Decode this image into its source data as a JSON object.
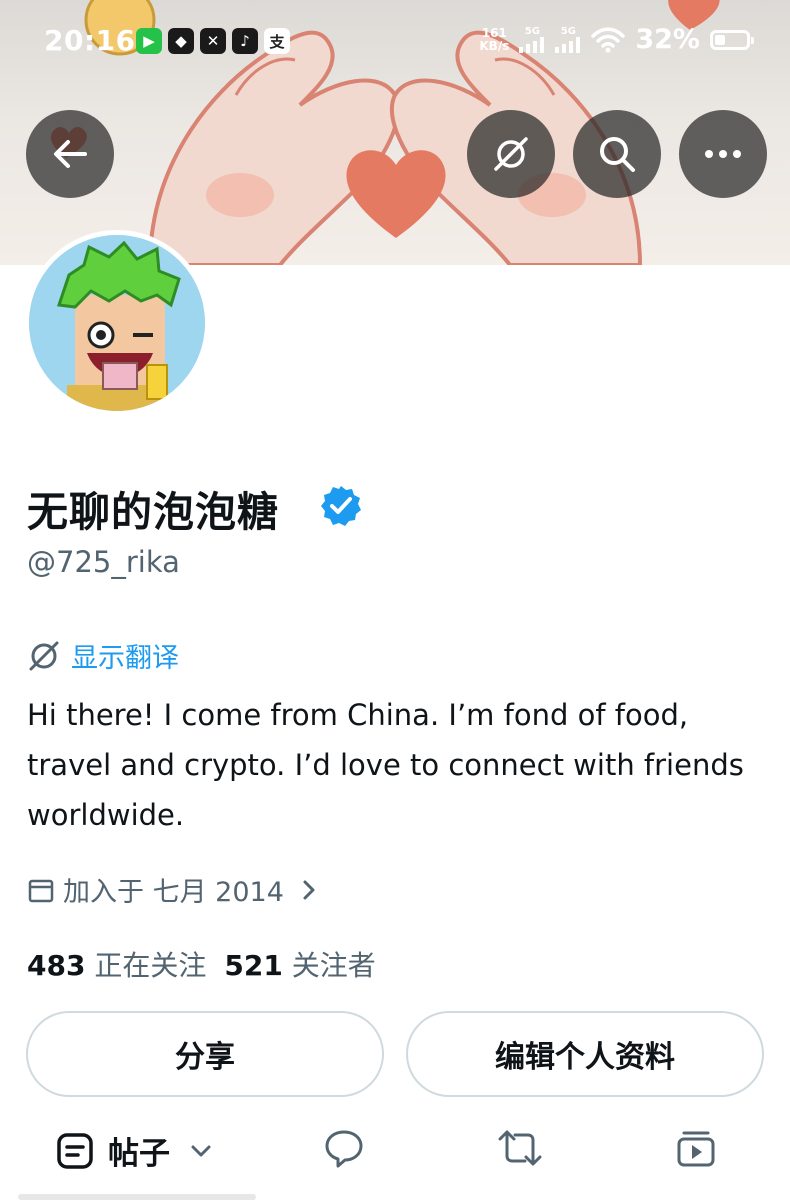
{
  "status_bar": {
    "time": "20:16",
    "net_speed_value": "161",
    "net_speed_unit": "KB/s",
    "signal_1": "5G",
    "signal_2": "5G",
    "battery_percent": "32%",
    "battery_level": 0.32,
    "app_icons": [
      "facetime-icon",
      "binance-icon",
      "x-icon",
      "tiktok-icon",
      "alipay-icon"
    ]
  },
  "profile": {
    "display_name": "无聊的泡泡糖",
    "handle": "@725_rika",
    "verified": true,
    "translate_label": "显示翻译",
    "bio": "Hi there! I come from China. I’m fond of food, travel and crypto. I’d love to connect with friends worldwide.",
    "joined": "加入于 七月 2014",
    "following_count": "483",
    "following_label": "正在关注",
    "followers_count": "521",
    "followers_label": "关注者"
  },
  "actions": {
    "share_label": "分享",
    "edit_label": "编辑个人资料"
  },
  "tabs": {
    "posts_label": "帖子"
  },
  "colors": {
    "accent": "#1d9bf0",
    "secondary_text": "#536471",
    "heart": "#e57a63"
  }
}
